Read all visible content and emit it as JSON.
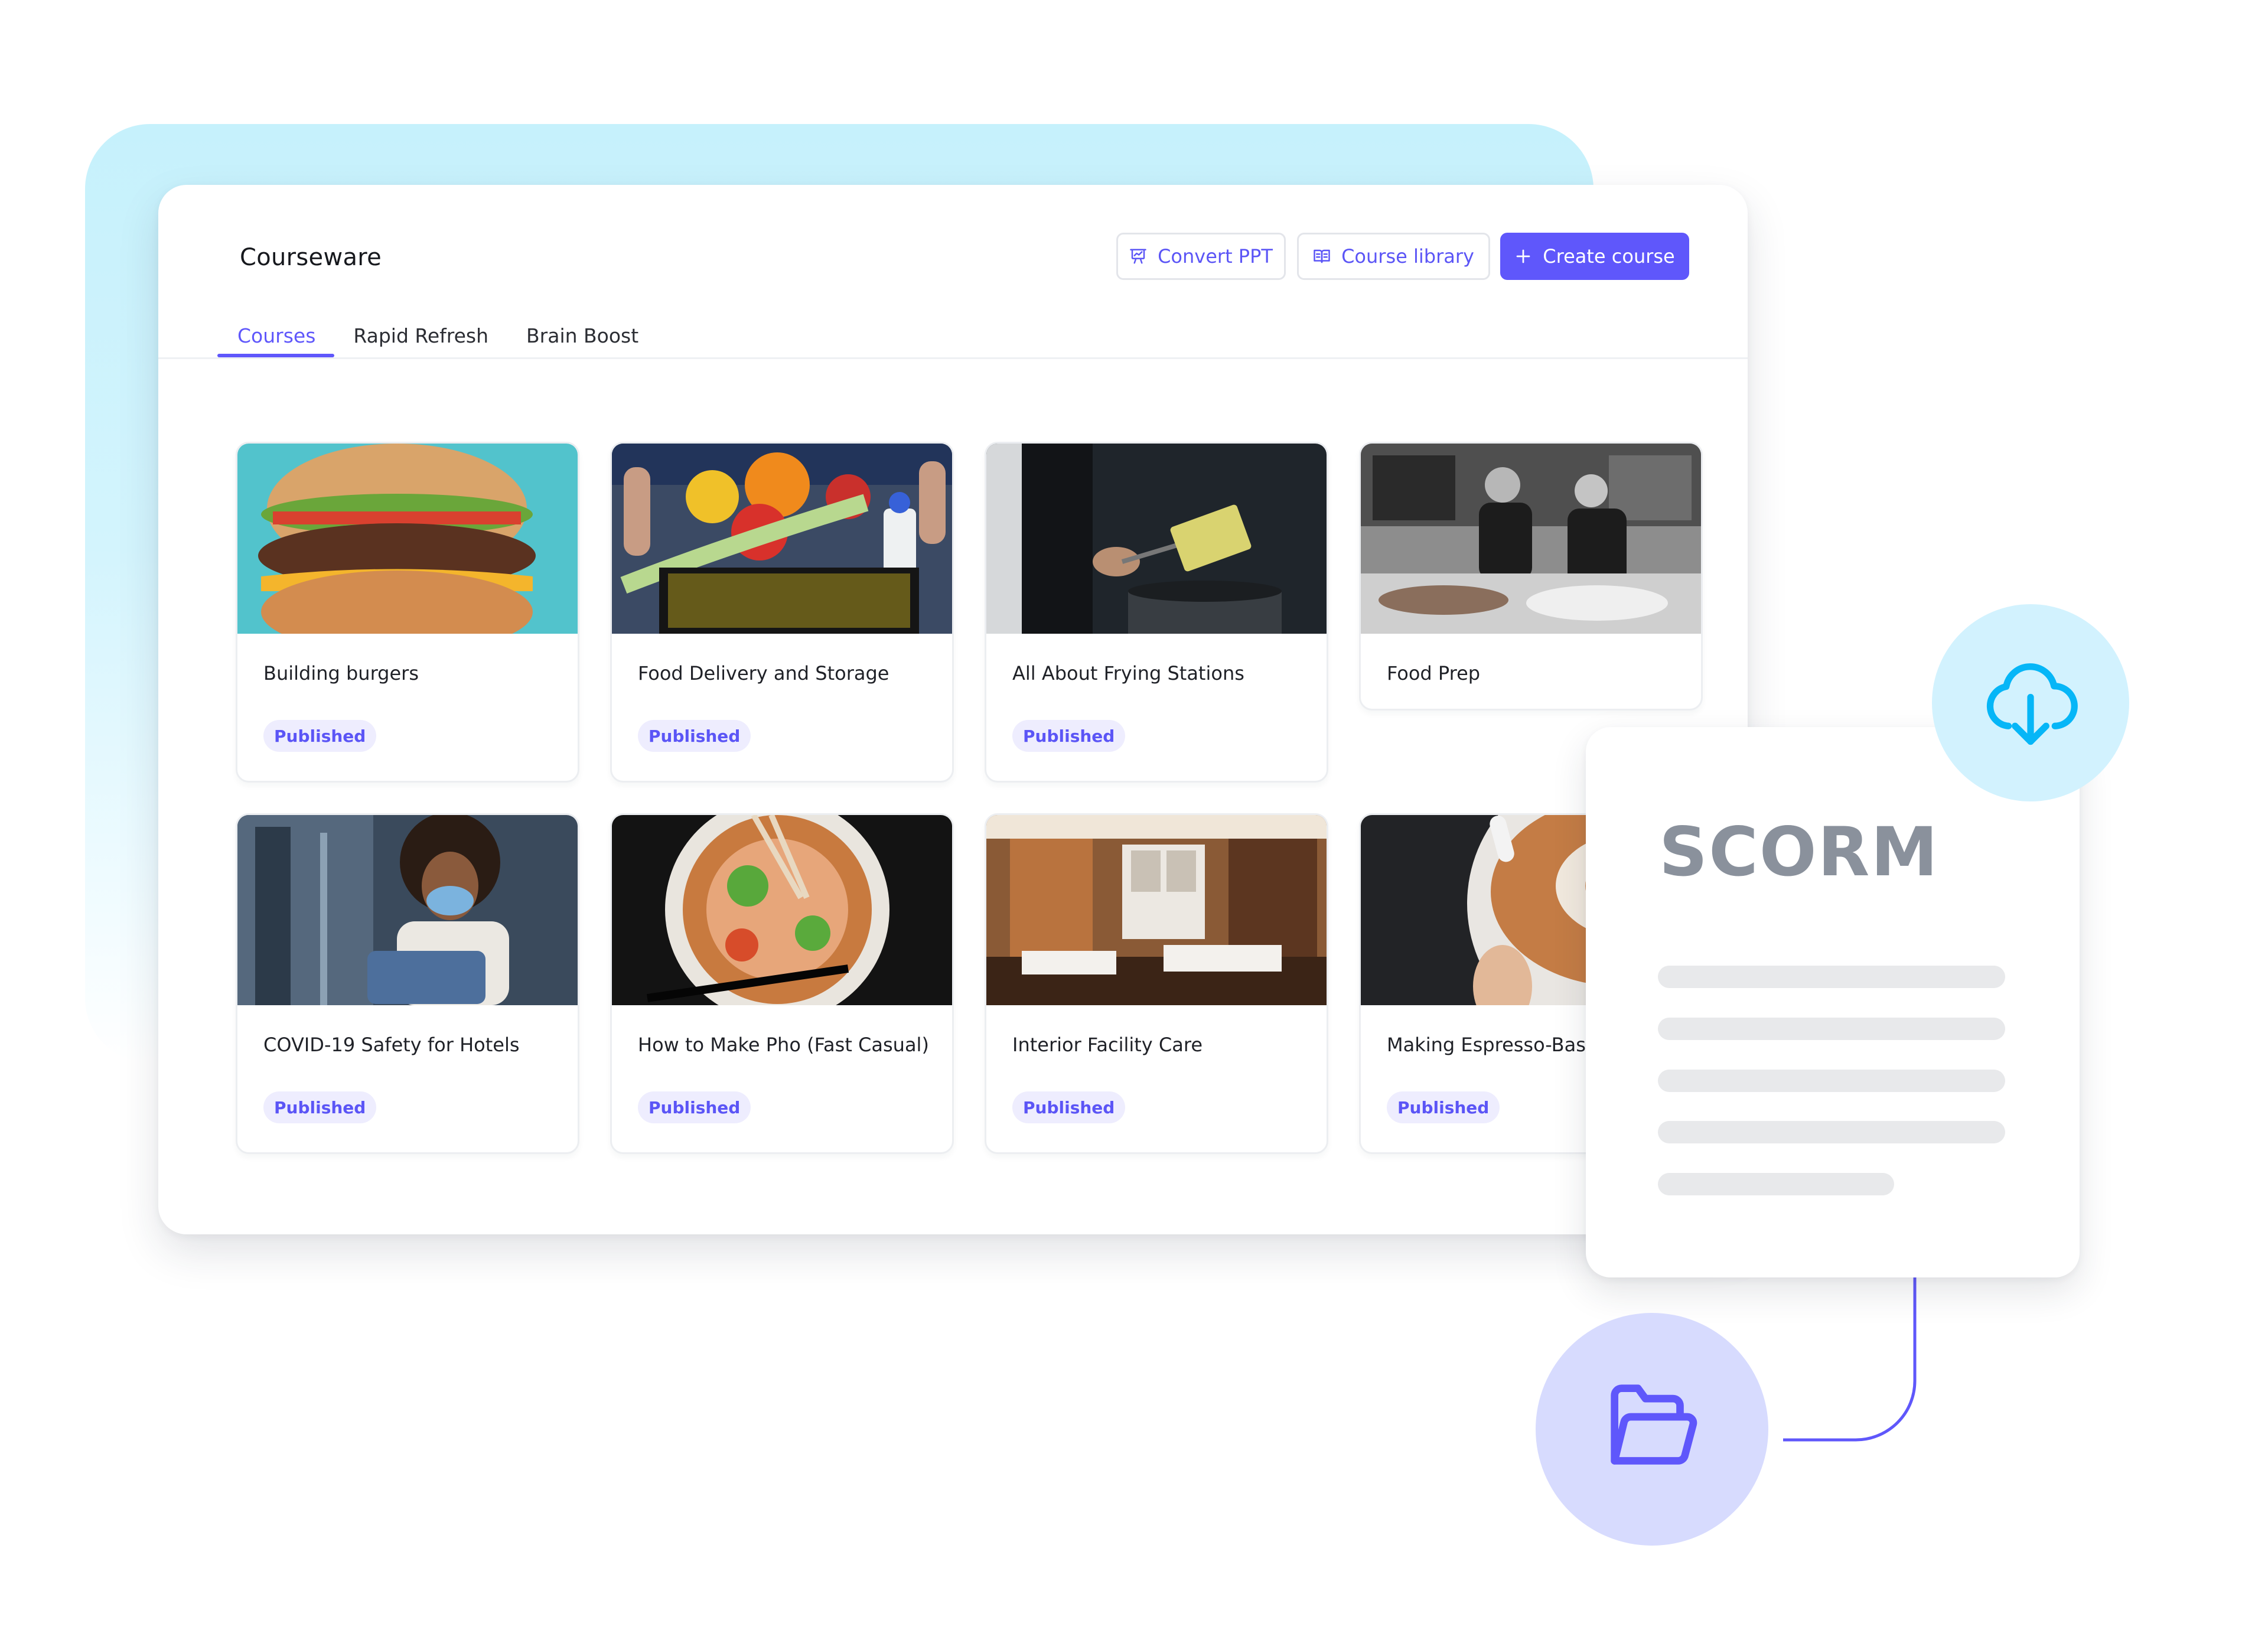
{
  "header": {
    "title": "Courseware",
    "buttons": {
      "convert_ppt": {
        "label": "Convert PPT",
        "icon": "presentation-icon"
      },
      "course_library": {
        "label": "Course library",
        "icon": "book-icon"
      },
      "create_course": {
        "label": "Create course",
        "icon": "plus-icon"
      }
    }
  },
  "tabs": [
    {
      "label": "Courses",
      "active": true
    },
    {
      "label": "Rapid Refresh",
      "active": false
    },
    {
      "label": "Brain Boost",
      "active": false
    }
  ],
  "courses": [
    {
      "title": "Building burgers",
      "status": "Published",
      "image": "burger"
    },
    {
      "title": "Food Delivery and Storage",
      "status": "Published",
      "image": "grocery-basket"
    },
    {
      "title": "All About Frying Stations",
      "status": "Published",
      "image": "fryer"
    },
    {
      "title": "Food Prep",
      "status": "",
      "image": "kitchen-chefs"
    },
    {
      "title": "COVID-19 Safety for Hotels",
      "status": "Published",
      "image": "masked-housekeeper"
    },
    {
      "title": "How to Make Pho (Fast Casual)",
      "status": "Published",
      "image": "pho-bowl"
    },
    {
      "title": "Interior Facility Care",
      "status": "Published",
      "image": "restaurant-interior"
    },
    {
      "title": "Making Espresso-Based",
      "status": "Published",
      "image": "latte-art"
    }
  ],
  "scorm_card": {
    "title": "SCORM",
    "placeholder_lines": 5
  },
  "icons": {
    "download": "cloud-download-icon",
    "folder": "folder-open-icon"
  },
  "colors": {
    "accent": "#5f57fb",
    "badge_bg": "#eeedfe",
    "cloud_circle": "#d2f2fe",
    "cloud_icon": "#06b6f7",
    "folder_circle": "#d7dbfe",
    "backdrop": "#c6f1fc",
    "scorm_text": "#8a919c"
  }
}
